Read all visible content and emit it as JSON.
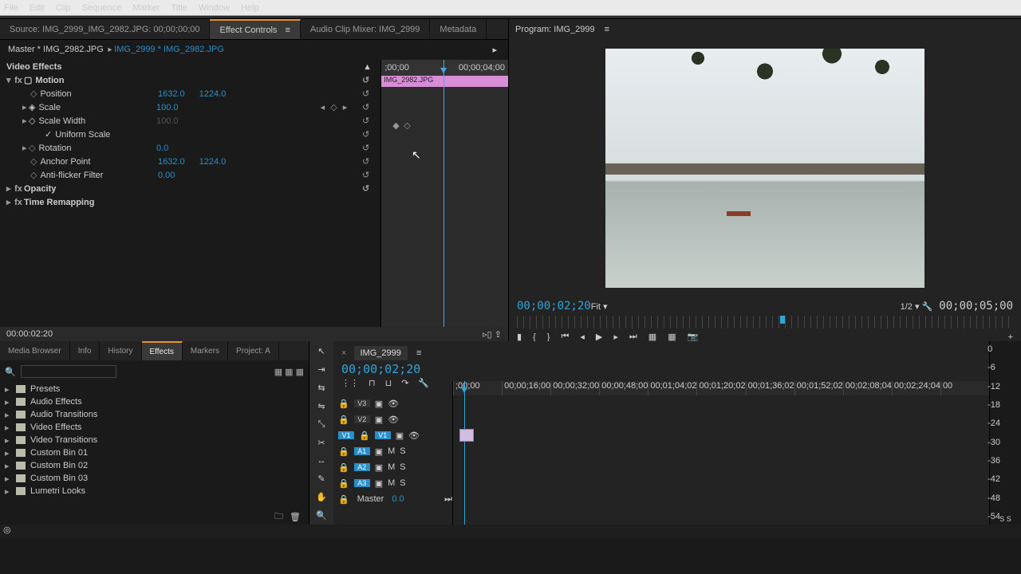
{
  "menu": [
    "File",
    "Edit",
    "Clip",
    "Sequence",
    "Marker",
    "Title",
    "Window",
    "Help"
  ],
  "source_tabs": {
    "source": "Source: IMG_2999_IMG_2982.JPG: 00;00;00;00",
    "effect_controls": "Effect Controls",
    "audio_mixer": "Audio Clip Mixer: IMG_2999",
    "metadata": "Metadata"
  },
  "ec": {
    "master": "Master * IMG_2982.JPG",
    "seq_link": "IMG_2999 * IMG_2982.JPG",
    "video_effects": "Video Effects",
    "motion": "Motion",
    "position_label": "Position",
    "position_x": "1632.0",
    "position_y": "1224.0",
    "scale_label": "Scale",
    "scale_val": "100.0",
    "scale_width_label": "Scale Width",
    "scale_width_val": "100.0",
    "uniform": "Uniform Scale",
    "rotation_label": "Rotation",
    "rotation_val": "0.0",
    "anchor_label": "Anchor Point",
    "anchor_x": "1632.0",
    "anchor_y": "1224.0",
    "flicker_label": "Anti-flicker Filter",
    "flicker_val": "0.00",
    "opacity": "Opacity",
    "time_remap": "Time Remapping",
    "footer_tc": "00:00:02:20",
    "ruler_start": ";00;00",
    "ruler_end": "00;00;04;00",
    "clip_name": "IMG_2982.JPG"
  },
  "program": {
    "title": "Program: IMG_2999",
    "tc_left": "00;00;02;20",
    "fit": "Fit",
    "quality": "1/2",
    "tc_right": "00;00;05;00"
  },
  "effects_panel": {
    "tabs": [
      "Media Browser",
      "Info",
      "History",
      "Effects",
      "Markers",
      "Project: A"
    ],
    "active": "Effects",
    "items": [
      "Presets",
      "Audio Effects",
      "Audio Transitions",
      "Video Effects",
      "Video Transitions",
      "Custom Bin 01",
      "Custom Bin 02",
      "Custom Bin 03",
      "Lumetri Looks"
    ],
    "search_placeholder": ""
  },
  "timeline": {
    "seq_name": "IMG_2999",
    "tc": "00;00;02;20",
    "ruler": [
      ";00;00",
      "00;00;16;00",
      "00;00;32;00",
      "00;00;48;00",
      "00;01;04;02",
      "00;01;20;02",
      "00;01;36;02",
      "00;01;52;02",
      "00;02;08;04",
      "00;02;24;04",
      "00"
    ],
    "v_tracks": [
      "V3",
      "V2",
      "V1"
    ],
    "a_tracks": [
      "A1",
      "A2",
      "A3"
    ],
    "master_label": "Master",
    "master_val": "0.0",
    "src_v": "V1"
  },
  "meter_scale": [
    "0",
    "-6",
    "-12",
    "-18",
    "-24",
    "-30",
    "-36",
    "-42",
    "-48",
    "-54"
  ],
  "meter_footer": "S   S"
}
